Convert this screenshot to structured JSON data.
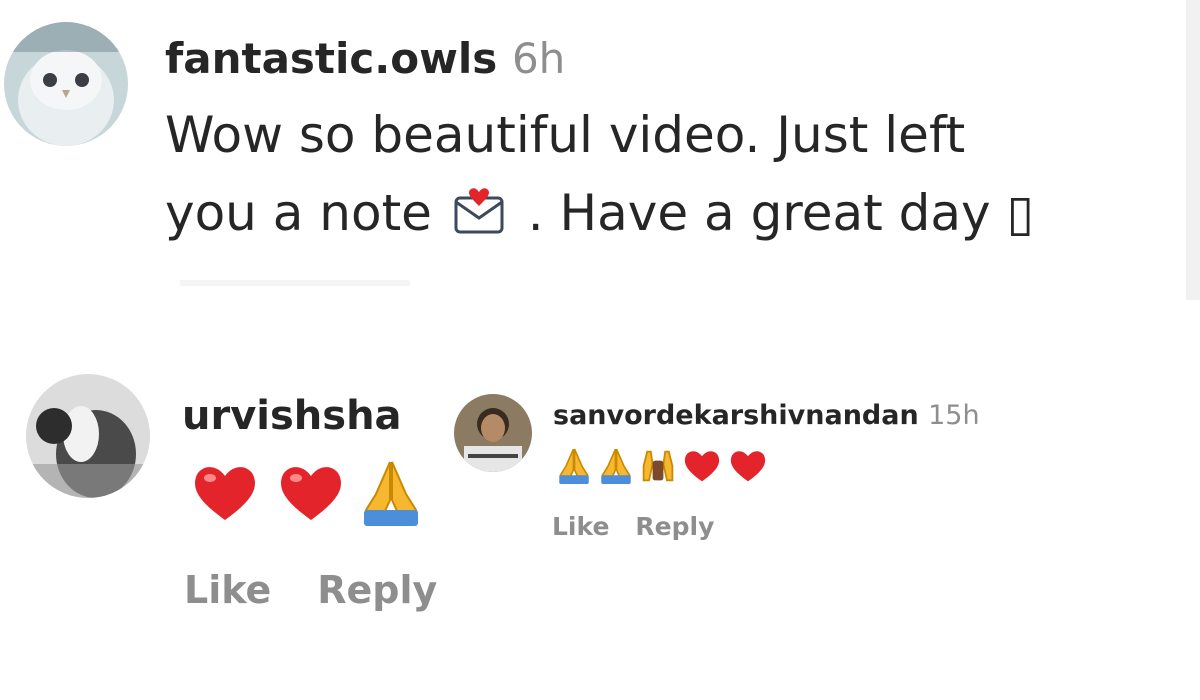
{
  "comments": [
    {
      "username": "fantastic.owls",
      "time": "6h",
      "lines": [
        "Wow so beautiful video. Just left",
        "you a note",
        ". Have a great day ▯"
      ],
      "avatar_icon": "owl-avatar"
    },
    {
      "username": "urvishsha",
      "emojis": [
        "red-heart-icon",
        "red-heart-icon",
        "folded-hands-icon"
      ],
      "like_label": "Like",
      "reply_label": "Reply",
      "avatar_icon": "cat-avatar"
    },
    {
      "username": "sanvordekarshivnandan",
      "time": "15h",
      "emojis": [
        "folded-hands-icon",
        "folded-hands-icon",
        "raised-hands-icon",
        "red-heart-icon",
        "red-heart-icon"
      ],
      "like_label": "Like",
      "reply_label": "Reply",
      "avatar_icon": "person-avatar"
    }
  ],
  "colors": {
    "text": "#262626",
    "muted": "#8e8e8e",
    "heart": "#e3242b",
    "hands": "#f7b731"
  }
}
